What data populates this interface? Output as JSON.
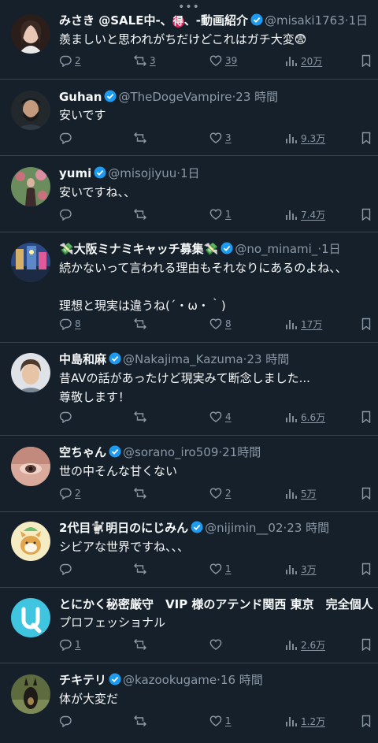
{
  "header": {
    "handle_dots": "•••"
  },
  "tweets": [
    {
      "name": "みさき @SALE中-",
      "name_tail": "お得",
      "name_badge": "得",
      "name_end": "-動画紹介",
      "handle": "@misaki1763",
      "time": "1日",
      "lines": [
        "羨ましいと思われがちだけどこれはガチ大変😨"
      ],
      "reply": "2",
      "retweet": "3",
      "like": "39",
      "views": "20万",
      "avatar_colors": [
        "#2a1d1a",
        "#e9c7b5",
        "#3b2a24"
      ]
    },
    {
      "name": "Guhan",
      "handle": "@TheDogeVampire",
      "time": "23 時間",
      "lines": [
        "安いです"
      ],
      "reply": "",
      "retweet": "",
      "like": "3",
      "views": "9.3万",
      "avatar_colors": [
        "#23282c",
        "#c39a7d",
        "#111"
      ]
    },
    {
      "name": "yumi",
      "handle": "@misojiyuu",
      "time": "1日",
      "lines": [
        "安いですね、、"
      ],
      "reply": "",
      "retweet": "",
      "like": "1",
      "views": "7.4万",
      "avatar_colors": [
        "#6b8d5e",
        "#c8717d",
        "#d8b3a0"
      ]
    },
    {
      "name": "💸大阪ミナミキャッチ募集💸",
      "handle": "@no_minami_",
      "time": "1日",
      "lines": [
        "続かないって言われる理由もそれなりにあるのよね、、",
        "",
        "理想と現実は違うね(´・ω・｀)"
      ],
      "reply": "8",
      "retweet": "",
      "like": "8",
      "views": "17万",
      "avatar_colors": [
        "#2b4a86",
        "#d7b067",
        "#5d89c8"
      ]
    },
    {
      "name": "中島和麻",
      "handle": "@Nakajima_Kazuma",
      "time": "23 時間",
      "lines": [
        "昔AVの話があったけど現実みて断念しました...",
        "尊敬します！"
      ],
      "reply": "",
      "retweet": "",
      "like": "4",
      "views": "6.6万",
      "avatar_colors": [
        "#dfe2e6",
        "#e8c4a6",
        "#4d3a2a"
      ]
    },
    {
      "name": "空ちゃん",
      "handle": "@sorano_iro509",
      "time": "21時間",
      "lines": [
        "世の中そんな甘くない"
      ],
      "reply": "2",
      "retweet": "",
      "like": "2",
      "views": "5万",
      "avatar_colors": [
        "#d9a99b",
        "#efd3c8",
        "#5a3d35"
      ]
    },
    {
      "name": "2代目🐩明日のにじみん",
      "handle": "@nijimin__02",
      "time": "23 時間",
      "lines": [
        "シビアな世界ですね、、、"
      ],
      "reply": "",
      "retweet": "",
      "like": "1",
      "views": "3万",
      "avatar_colors": [
        "#f6ecc3",
        "#e3a54c",
        "#3a3a3a"
      ]
    },
    {
      "name": "とにかく秘密厳守　VIP 様のアテンド関西 東京　完全個人...",
      "handle": "",
      "time": "",
      "lines": [
        "プロフェッショナル"
      ],
      "reply": "1",
      "retweet": "",
      "like": "",
      "views": "2.6万",
      "avatar_colors": [
        "#3fc5e0",
        "#ffffff",
        "#3fc5e0"
      ]
    },
    {
      "name": "チキテリ",
      "handle": "@kazookugame",
      "time": "16 時間",
      "lines": [
        "体が大変だ"
      ],
      "reply": "",
      "retweet": "",
      "like": "1",
      "views": "1.2万",
      "avatar_colors": [
        "#5d6b3f",
        "#1e1a17",
        "#a0834f"
      ]
    }
  ],
  "colors": {
    "bg": "#15202b",
    "text": "#f7f9f9",
    "muted": "#8b98a5",
    "verified": "#1d9bf0",
    "divider": "#38444d"
  }
}
